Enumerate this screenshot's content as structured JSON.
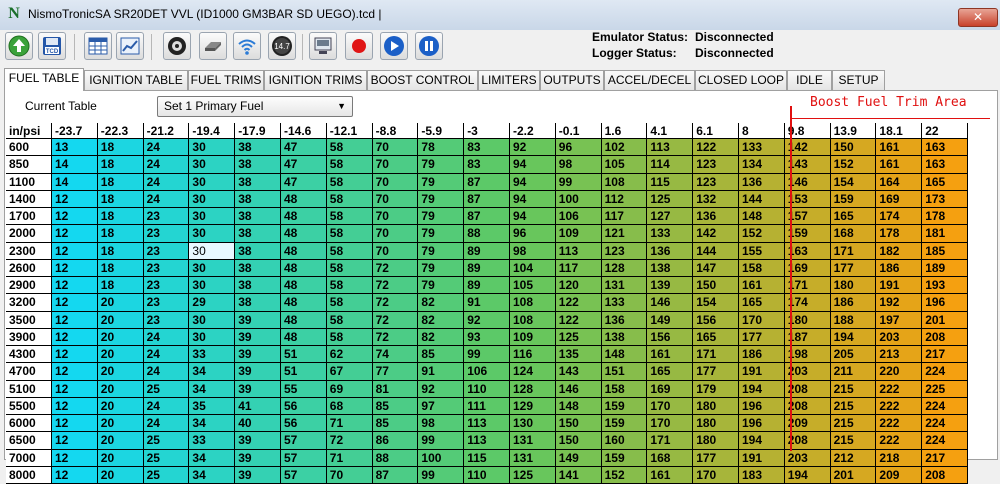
{
  "window": {
    "title": "NismoTronicSA  SR20DET VVL (ID1000 GM3BAR SD UEGO).tcd |",
    "app_icon": "N",
    "close_label": "✕"
  },
  "toolbar": {
    "buttons": [
      {
        "name": "upload-button",
        "icon": "upload-icon"
      },
      {
        "name": "save-tcd-button",
        "icon": "save-tcd-icon",
        "label": "TCD"
      },
      {
        "name": "table-view-button",
        "icon": "table-icon"
      },
      {
        "name": "chart-view-button",
        "icon": "chart-icon"
      },
      {
        "name": "gauges-button",
        "icon": "gauge-icon"
      },
      {
        "name": "device-button",
        "icon": "device-icon"
      },
      {
        "name": "wifi-button",
        "icon": "wifi-icon"
      },
      {
        "name": "voltage-button",
        "icon": "voltage-icon",
        "label": "14.7"
      },
      {
        "name": "monitor-button",
        "icon": "monitor-icon"
      },
      {
        "name": "record-button",
        "icon": "record-icon"
      },
      {
        "name": "play-button",
        "icon": "play-icon"
      },
      {
        "name": "pause-button",
        "icon": "pause-icon"
      }
    ]
  },
  "status": {
    "emulator_label": "Emulator Status:",
    "emulator_value": "Disconnected",
    "logger_label": "Logger Status:",
    "logger_value": "Disconnected"
  },
  "tabs": [
    {
      "label": "FUEL TABLE",
      "active": true
    },
    {
      "label": "IGNITION TABLE"
    },
    {
      "label": "FUEL TRIMS"
    },
    {
      "label": "IGNITION TRIMS"
    },
    {
      "label": "BOOST CONTROL"
    },
    {
      "label": "LIMITERS"
    },
    {
      "label": "OUTPUTS"
    },
    {
      "label": "ACCEL/DECEL"
    },
    {
      "label": "CLOSED LOOP"
    },
    {
      "label": "IDLE"
    },
    {
      "label": "SETUP"
    }
  ],
  "current_table": {
    "label": "Current Table",
    "value": "Set 1 Primary Fuel"
  },
  "annotation": {
    "text": "Boost Fuel Trim Area",
    "color": "#e01010"
  },
  "fuel_table": {
    "corner": "in/psi",
    "columns": [
      "-23.7",
      "-22.3",
      "-21.2",
      "-19.4",
      "-17.9",
      "-14.6",
      "-12.1",
      "-8.8",
      "-5.9",
      "-3",
      "-2.2",
      "-0.1",
      "1.6",
      "4.1",
      "6.1",
      "8",
      "9.8",
      "13.9",
      "18.1",
      "22"
    ],
    "rows": [
      {
        "rpm": "600",
        "values": [
          13,
          18,
          24,
          30,
          38,
          47,
          58,
          70,
          78,
          83,
          92,
          96,
          102,
          113,
          122,
          133,
          142,
          150,
          161,
          163
        ]
      },
      {
        "rpm": "850",
        "values": [
          14,
          18,
          24,
          30,
          38,
          47,
          58,
          70,
          79,
          83,
          94,
          98,
          105,
          114,
          123,
          134,
          143,
          152,
          161,
          163
        ]
      },
      {
        "rpm": "1100",
        "values": [
          14,
          18,
          24,
          30,
          38,
          47,
          58,
          70,
          79,
          87,
          94,
          99,
          108,
          115,
          123,
          136,
          146,
          154,
          164,
          165
        ]
      },
      {
        "rpm": "1400",
        "values": [
          12,
          18,
          24,
          30,
          38,
          48,
          58,
          70,
          79,
          87,
          94,
          100,
          112,
          125,
          132,
          144,
          153,
          159,
          169,
          173
        ]
      },
      {
        "rpm": "1700",
        "values": [
          12,
          18,
          23,
          30,
          38,
          48,
          58,
          70,
          79,
          87,
          94,
          106,
          117,
          127,
          136,
          148,
          157,
          165,
          174,
          178
        ]
      },
      {
        "rpm": "2000",
        "values": [
          12,
          18,
          23,
          30,
          38,
          48,
          58,
          70,
          79,
          88,
          96,
          109,
          121,
          133,
          142,
          152,
          159,
          168,
          178,
          181
        ]
      },
      {
        "rpm": "2300",
        "values": [
          12,
          18,
          23,
          30,
          38,
          48,
          58,
          70,
          79,
          89,
          98,
          113,
          123,
          136,
          144,
          155,
          163,
          171,
          182,
          185
        ]
      },
      {
        "rpm": "2600",
        "values": [
          12,
          18,
          23,
          30,
          38,
          48,
          58,
          72,
          79,
          89,
          104,
          117,
          128,
          138,
          147,
          158,
          169,
          177,
          186,
          189
        ]
      },
      {
        "rpm": "2900",
        "values": [
          12,
          18,
          23,
          30,
          38,
          48,
          58,
          72,
          79,
          89,
          105,
          120,
          131,
          139,
          150,
          161,
          171,
          180,
          191,
          193
        ]
      },
      {
        "rpm": "3200",
        "values": [
          12,
          20,
          23,
          29,
          38,
          48,
          58,
          72,
          82,
          91,
          108,
          122,
          133,
          146,
          154,
          165,
          174,
          186,
          192,
          196
        ]
      },
      {
        "rpm": "3500",
        "values": [
          12,
          20,
          23,
          30,
          39,
          48,
          58,
          72,
          82,
          92,
          108,
          122,
          136,
          149,
          156,
          170,
          180,
          188,
          197,
          201
        ]
      },
      {
        "rpm": "3900",
        "values": [
          12,
          20,
          24,
          30,
          39,
          48,
          58,
          72,
          82,
          93,
          109,
          125,
          138,
          156,
          165,
          177,
          187,
          194,
          203,
          208
        ]
      },
      {
        "rpm": "4300",
        "values": [
          12,
          20,
          24,
          33,
          39,
          51,
          62,
          74,
          85,
          99,
          116,
          135,
          148,
          161,
          171,
          186,
          198,
          205,
          213,
          217
        ]
      },
      {
        "rpm": "4700",
        "values": [
          12,
          20,
          24,
          34,
          39,
          51,
          67,
          77,
          91,
          106,
          124,
          143,
          151,
          165,
          177,
          191,
          203,
          211,
          220,
          224
        ]
      },
      {
        "rpm": "5100",
        "values": [
          12,
          20,
          25,
          34,
          39,
          55,
          69,
          81,
          92,
          110,
          128,
          146,
          158,
          169,
          179,
          194,
          208,
          215,
          222,
          225
        ]
      },
      {
        "rpm": "5500",
        "values": [
          12,
          20,
          24,
          35,
          41,
          56,
          68,
          85,
          97,
          111,
          129,
          148,
          159,
          170,
          180,
          196,
          208,
          215,
          222,
          224
        ]
      },
      {
        "rpm": "6000",
        "values": [
          12,
          20,
          24,
          34,
          40,
          56,
          71,
          85,
          98,
          113,
          130,
          150,
          159,
          170,
          180,
          196,
          209,
          215,
          222,
          224
        ]
      },
      {
        "rpm": "6500",
        "values": [
          12,
          20,
          25,
          33,
          39,
          57,
          72,
          86,
          99,
          113,
          131,
          150,
          160,
          171,
          180,
          194,
          208,
          215,
          222,
          224
        ]
      },
      {
        "rpm": "7000",
        "values": [
          12,
          20,
          25,
          34,
          39,
          57,
          71,
          88,
          100,
          115,
          131,
          149,
          159,
          168,
          177,
          191,
          203,
          212,
          218,
          217
        ]
      },
      {
        "rpm": "8000",
        "values": [
          12,
          20,
          25,
          34,
          39,
          57,
          70,
          87,
          99,
          110,
          125,
          141,
          152,
          161,
          170,
          183,
          194,
          201,
          209,
          208
        ]
      }
    ],
    "selected_cell": {
      "rpm": "2300",
      "column": "-19.4"
    },
    "colors": {
      "low": "#14d8f0",
      "mid": "#60c860",
      "high": "#f5a010",
      "selected": "#e8f8ff"
    }
  }
}
